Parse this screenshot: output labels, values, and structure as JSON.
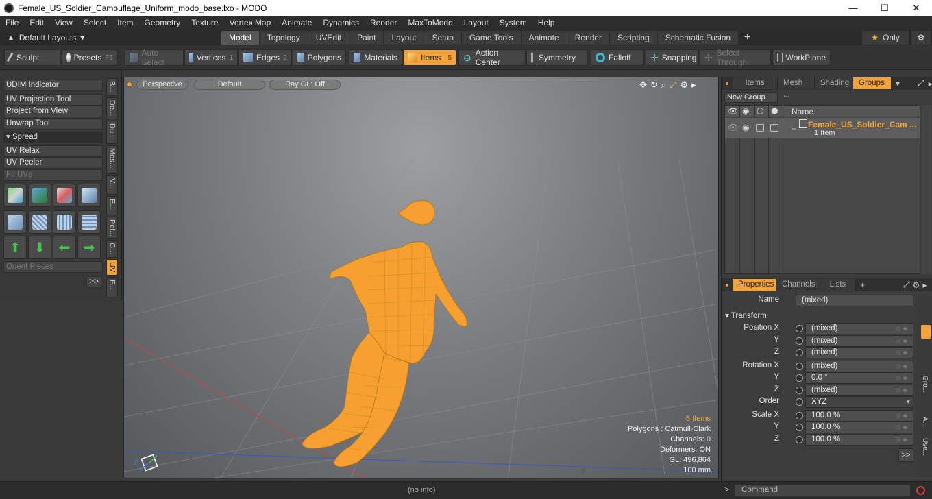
{
  "window": {
    "title": "Female_US_Soldier_Camouflage_Uniform_modo_base.lxo - MODO",
    "minimize": "—",
    "maximize": "☐",
    "close": "✕"
  },
  "menu": [
    "File",
    "Edit",
    "View",
    "Select",
    "Item",
    "Geometry",
    "Texture",
    "Vertex Map",
    "Animate",
    "Dynamics",
    "Render",
    "MaxToModo",
    "Layout",
    "System",
    "Help"
  ],
  "layout_bar": {
    "layout_select": "Default Layouts",
    "tabs": [
      "Model",
      "Topology",
      "UVEdit",
      "Paint",
      "Layout",
      "Setup",
      "Game Tools",
      "Animate",
      "Render",
      "Scripting",
      "Schematic Fusion"
    ],
    "active_tab": "Model",
    "plus": "+",
    "only_label": "Only"
  },
  "toolbar": {
    "sculpt": "Sculpt",
    "presets": "Presets",
    "presets_key": "F6",
    "auto_select": "Auto Select",
    "vertices": "Vertices",
    "vertices_key": "1",
    "edges": "Edges",
    "edges_key": "2",
    "polygons": "Polygons",
    "materials": "Materials",
    "items": "Items",
    "items_key": "5",
    "action_center": "Action Center",
    "symmetry": "Symmetry",
    "falloff": "Falloff",
    "snapping": "Snapping",
    "select_through": "Select Through",
    "workplane": "WorkPlane"
  },
  "left_panel": {
    "udim": "UDIM Indicator",
    "uv_projection": "UV Projection Tool",
    "project_view": "Project from View",
    "unwrap": "Unwrap Tool",
    "spread": "Spread",
    "uv_relax": "UV Relax",
    "uv_peeler": "UV Peeler",
    "fit_uvs": "Fit UVs",
    "orient_pieces": "Orient Pieces",
    "more": ">>",
    "vtabs": [
      "B...",
      "De...",
      "Du...",
      "Mes...",
      "V...",
      "E...",
      "Pol...",
      "C...",
      "UV",
      "F..."
    ]
  },
  "viewport": {
    "view": "Perspective",
    "shading": "Default",
    "raygl": "Ray GL: Off",
    "stats": {
      "items": "5 Items",
      "polygons": "Polygons : Catmull-Clark",
      "channels": "Channels: 0",
      "deformers": "Deformers: ON",
      "gl": "GL: 496,864",
      "scale": "100 mm"
    },
    "axis_z": "-Z",
    "gizmo_z": "Z"
  },
  "groups_panel": {
    "tabs": [
      "Items",
      "Mesh ...",
      "Shading",
      "Groups"
    ],
    "active_tab": "Groups",
    "new_group": "New Group",
    "col_name": "Name",
    "group_name": "Female_US_Soldier_Cam ...",
    "group_count": "1 Item"
  },
  "properties_panel": {
    "tabs": [
      "Properties",
      "Channels",
      "Lists"
    ],
    "active_tab": "Properties",
    "name_label": "Name",
    "name_value": "(mixed)",
    "transform_label": "Transform",
    "rows": [
      {
        "label": "Position X",
        "value": "(mixed)"
      },
      {
        "label": "Y",
        "value": "(mixed)"
      },
      {
        "label": "Z",
        "value": "(mixed)"
      },
      {
        "label": "Rotation X",
        "value": "(mixed)"
      },
      {
        "label": "Y",
        "value": "0.0 °"
      },
      {
        "label": "Z",
        "value": "(mixed)"
      },
      {
        "label": "Order",
        "value": "XYZ"
      },
      {
        "label": "Scale X",
        "value": "100.0 %"
      },
      {
        "label": "Y",
        "value": "100.0 %"
      },
      {
        "label": "Z",
        "value": "100.0 %"
      }
    ],
    "more": ">>",
    "side_tabs": [
      "Gro...",
      "A...",
      "Use..."
    ]
  },
  "status": {
    "info": "(no info)",
    "prompt": ">",
    "command_placeholder": "Command"
  },
  "colors": {
    "accent": "#f3a33a",
    "mesh": "#f5a030"
  }
}
